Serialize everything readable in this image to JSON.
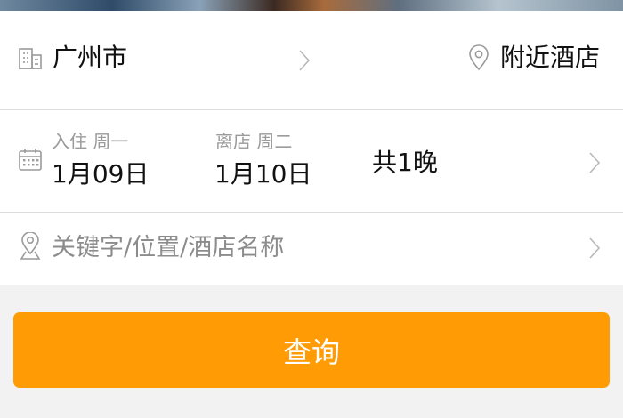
{
  "location": {
    "city": "广州市",
    "nearby_label": "附近酒店"
  },
  "dates": {
    "checkin_label": "入住 周一",
    "checkin_date": "1月09日",
    "checkout_label": "离店 周二",
    "checkout_date": "1月10日",
    "nights": "共1晚"
  },
  "keyword": {
    "value": "",
    "placeholder": "关键字/位置/酒店名称"
  },
  "search": {
    "label": "查询"
  },
  "colors": {
    "accent": "#ff9c05",
    "divider": "#dcdcdc",
    "muted_text": "#9b9b9b",
    "background": "#f2f2f2"
  },
  "icons": {
    "city": "building-icon",
    "nearby": "location-pin-icon",
    "dates": "calendar-icon",
    "keyword": "location-pin-icon",
    "chevron": "chevron-right-icon"
  }
}
